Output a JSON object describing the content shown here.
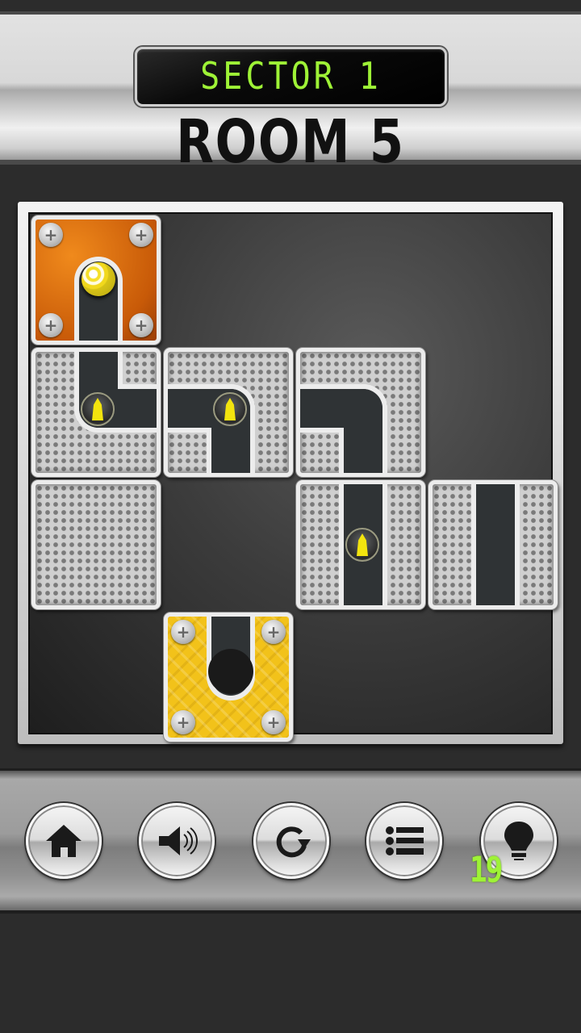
{
  "header": {
    "sector_label": "SECTOR 1",
    "room_label": "ROOM 5"
  },
  "board": {
    "grid": {
      "columns": 4,
      "rows": 4
    },
    "tiles": [
      {
        "type": "start",
        "color": "orange",
        "row": 0,
        "col": 0,
        "fixed": true,
        "pipe": "vertical-from-top-cap"
      },
      {
        "type": "pipe",
        "row": 1,
        "col": 0,
        "pipe": "top-to-right",
        "movable": true
      },
      {
        "type": "pipe",
        "row": 1,
        "col": 1,
        "pipe": "left-to-bottom",
        "movable": true
      },
      {
        "type": "pipe",
        "row": 1,
        "col": 2,
        "pipe": "left-to-bottom",
        "movable": true
      },
      {
        "type": "empty",
        "row": 2,
        "col": 0,
        "movable": true
      },
      {
        "type": "pipe",
        "row": 2,
        "col": 2,
        "pipe": "vertical",
        "movable": true
      },
      {
        "type": "pipe",
        "row": 2,
        "col": 3,
        "pipe": "vertical",
        "movable": true
      },
      {
        "type": "goal",
        "color": "yellow",
        "row": 3,
        "col": 1,
        "fixed": true,
        "pipe": "vertical-to-hole"
      }
    ],
    "stars_on_path": 3,
    "ball": "yellow-striped-ball"
  },
  "controls": {
    "buttons": [
      {
        "id": "home",
        "icon": "home-icon"
      },
      {
        "id": "sound",
        "icon": "speaker-icon"
      },
      {
        "id": "restart",
        "icon": "restart-icon"
      },
      {
        "id": "levels",
        "icon": "list-icon"
      },
      {
        "id": "hint",
        "icon": "lightbulb-icon"
      }
    ],
    "hint_count": "19"
  },
  "colors": {
    "lcd_green": "#9ef236",
    "start_tile": "#e0750f",
    "goal_tile": "#f2c21a",
    "pipe": "#2f3335"
  }
}
